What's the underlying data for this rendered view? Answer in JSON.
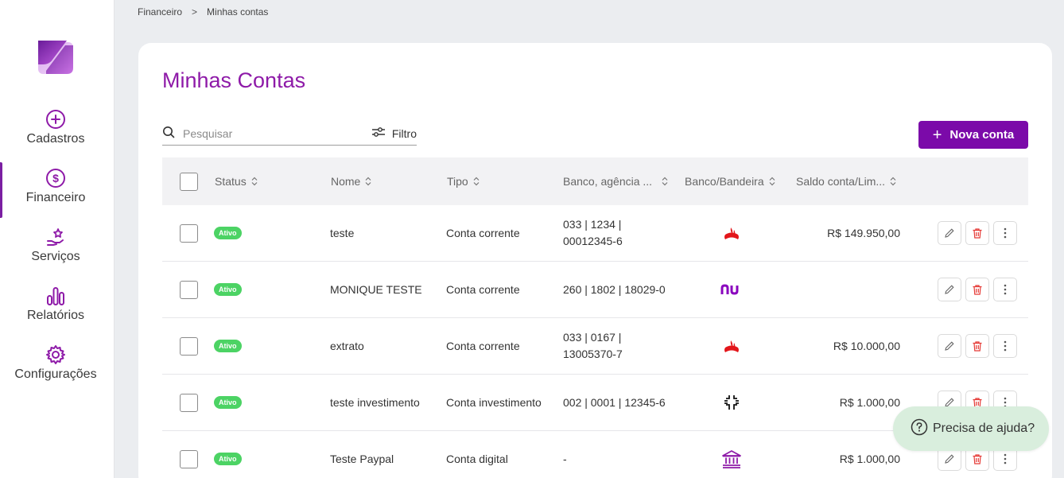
{
  "sidebar": {
    "items": [
      {
        "label": "Cadastros",
        "icon": "plus-circle-icon"
      },
      {
        "label": "Financeiro",
        "icon": "dollar-circle-icon"
      },
      {
        "label": "Serviços",
        "icon": "hand-star-icon"
      },
      {
        "label": "Relatórios",
        "icon": "bar-chart-icon"
      },
      {
        "label": "Configurações",
        "icon": "gear-icon"
      }
    ],
    "active": "Financeiro"
  },
  "breadcrumb": [
    "Financeiro",
    "Minhas contas"
  ],
  "page_title": "Minhas Contas",
  "search": {
    "placeholder": "Pesquisar"
  },
  "filter_label": "Filtro",
  "new_button_label": "Nova conta",
  "table": {
    "columns": [
      "Status",
      "Nome",
      "Tipo",
      "Banco, agência ...",
      "Banco/Bandeira",
      "Saldo conta/Lim..."
    ],
    "rows": [
      {
        "status": "Ativo",
        "nome": "teste",
        "tipo": "Conta corrente",
        "banco_line1": "033 | 1234 |",
        "banco_line2": "00012345-6",
        "bandeira": "santander-logo",
        "saldo": "R$  149.950,00"
      },
      {
        "status": "Ativo",
        "nome": "MONIQUE TESTE",
        "tipo": "Conta corrente",
        "banco_line1": "260 | 1802 | 18029-0",
        "banco_line2": "",
        "bandeira": "nubank-logo",
        "saldo": ""
      },
      {
        "status": "Ativo",
        "nome": "extrato",
        "tipo": "Conta corrente",
        "banco_line1": "033 | 0167 |",
        "banco_line2": "13005370-7",
        "bandeira": "santander-logo",
        "saldo": "R$  10.000,00"
      },
      {
        "status": "Ativo",
        "nome": "teste investimento",
        "tipo": "Conta investimento",
        "banco_line1": "002 | 0001 | 12345-6",
        "banco_line2": "",
        "bandeira": "generic-bank-logo",
        "saldo": "R$  1.000,00"
      },
      {
        "status": "Ativo",
        "nome": "Teste Paypal",
        "tipo": "Conta digital",
        "banco_line1": "-",
        "banco_line2": "",
        "bandeira": "bank-building-icon",
        "saldo": "R$  1.000,00"
      }
    ]
  },
  "help_label": "Precisa de ajuda?",
  "colors": {
    "accent": "#7b0aa9",
    "title": "#8e1aa8",
    "active_badge": "#4cd364",
    "delete": "#e53935"
  }
}
